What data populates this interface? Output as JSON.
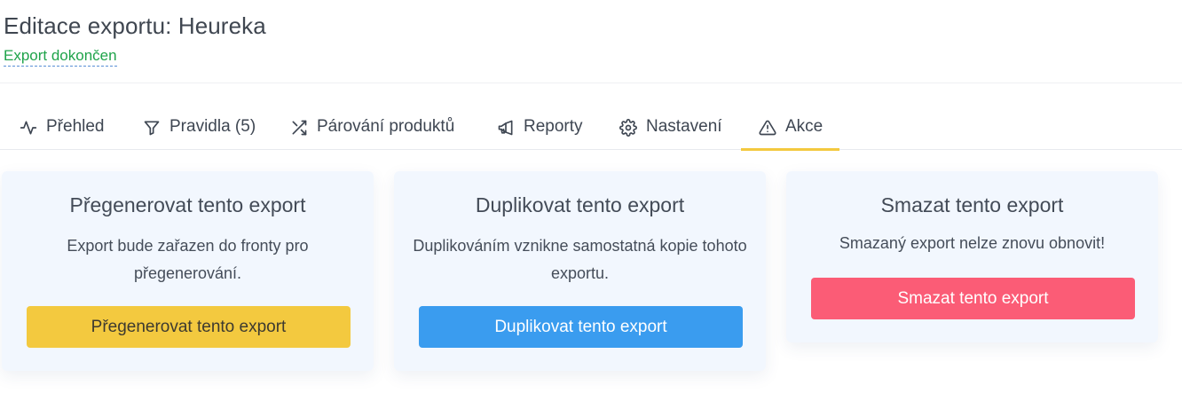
{
  "header": {
    "title": "Editace exportu: Heureka",
    "status": "Export dokončen"
  },
  "tabs": [
    {
      "label": "Přehled",
      "icon": "activity-icon"
    },
    {
      "label": "Pravidla (5)",
      "icon": "filter-icon"
    },
    {
      "label": "Párování produktů",
      "icon": "shuffle-icon"
    },
    {
      "label": "Reporty",
      "icon": "megaphone-icon"
    },
    {
      "label": "Nastavení",
      "icon": "gear-icon"
    },
    {
      "label": "Akce",
      "icon": "warning-icon",
      "active": true
    }
  ],
  "cards": {
    "regenerate": {
      "title": "Přegenerovat tento export",
      "description": "Export bude zařazen do fronty pro přegenerování.",
      "button": "Přegenerovat tento export"
    },
    "duplicate": {
      "title": "Duplikovat tento export",
      "description": "Duplikováním vznikne samostatná kopie tohoto exportu.",
      "button": "Duplikovat tento export"
    },
    "delete": {
      "title": "Smazat tento export",
      "description": "Smazaný export nelze znovu obnovit!",
      "button": "Smazat tento export"
    }
  },
  "colors": {
    "accent_yellow": "#f3c93f",
    "primary_blue": "#3a9cef",
    "danger_red": "#fb5c76",
    "success_green": "#1fa34a",
    "card_bg": "#f2f7fe"
  }
}
